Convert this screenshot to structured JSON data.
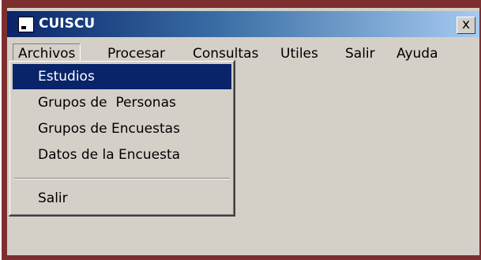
{
  "window": {
    "title": "CUISCU",
    "close_label": "x",
    "icon": "app-document-icon"
  },
  "menubar": {
    "items": [
      {
        "label": "Archivos"
      },
      {
        "label": "Procesar"
      },
      {
        "label": "Consultas"
      },
      {
        "label": "Utiles"
      },
      {
        "label": "Salir"
      },
      {
        "label": "Ayuda"
      }
    ]
  },
  "dropdown": {
    "items": [
      {
        "label": "Estudios",
        "selected": true
      },
      {
        "label": "Grupos de  Personas"
      },
      {
        "label": "Grupos de Encuestas"
      },
      {
        "label": "Datos de la Encuesta"
      },
      {
        "label": "Salir"
      }
    ]
  },
  "colors": {
    "titlebar_start": "#0a246a",
    "titlebar_end": "#a6caf0",
    "selection": "#0a246a",
    "frame": "#7d2f2f",
    "face": "#d4d0c8"
  }
}
